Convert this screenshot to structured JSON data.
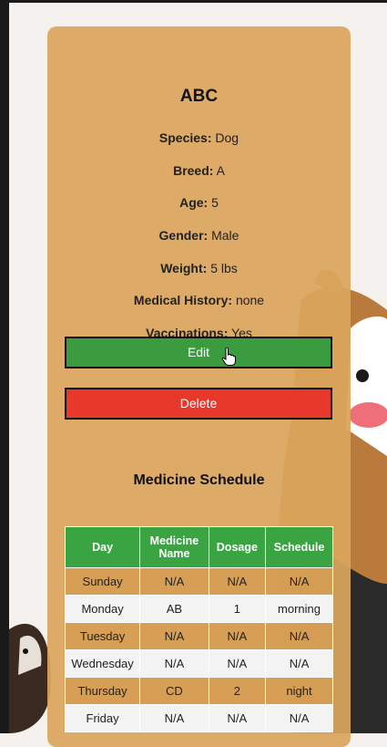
{
  "pet": {
    "name": "ABC",
    "fields": [
      {
        "label": "Species:",
        "value": "Dog"
      },
      {
        "label": "Breed:",
        "value": "A"
      },
      {
        "label": "Age:",
        "value": "5"
      },
      {
        "label": "Gender:",
        "value": "Male"
      },
      {
        "label": "Weight:",
        "value": "5 lbs"
      },
      {
        "label": "Medical History:",
        "value": "none"
      },
      {
        "label": "Vaccinations:",
        "value": "Yes"
      }
    ]
  },
  "actions": {
    "edit_label": "Edit",
    "delete_label": "Delete"
  },
  "schedule": {
    "title": "Medicine Schedule",
    "headers": [
      "Day",
      "Medicine Name",
      "Dosage",
      "Schedule"
    ],
    "rows": [
      {
        "day": "Sunday",
        "medicine": "N/A",
        "dosage": "N/A",
        "schedule": "N/A"
      },
      {
        "day": "Monday",
        "medicine": "AB",
        "dosage": "1",
        "schedule": "morning"
      },
      {
        "day": "Tuesday",
        "medicine": "N/A",
        "dosage": "N/A",
        "schedule": "N/A"
      },
      {
        "day": "Wednesday",
        "medicine": "N/A",
        "dosage": "N/A",
        "schedule": "N/A"
      },
      {
        "day": "Thursday",
        "medicine": "CD",
        "dosage": "2",
        "schedule": "night"
      },
      {
        "day": "Friday",
        "medicine": "N/A",
        "dosage": "N/A",
        "schedule": "N/A"
      }
    ]
  },
  "colors": {
    "card": "#DAA55D",
    "edit": "#3A9C3F",
    "delete": "#E8372B",
    "table_header": "#3AA443"
  }
}
